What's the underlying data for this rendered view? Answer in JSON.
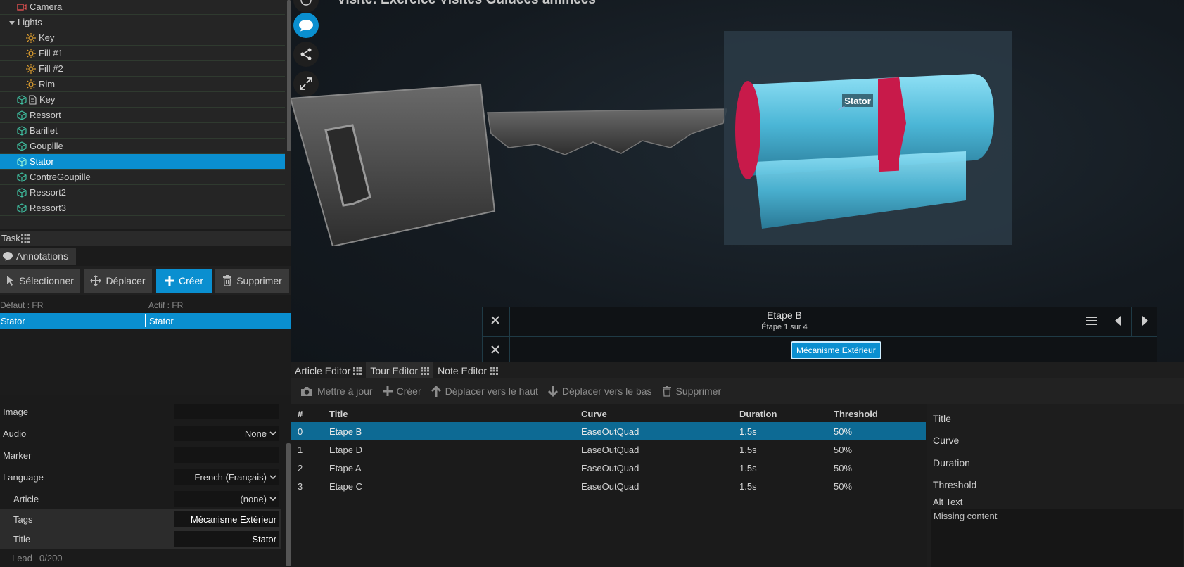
{
  "scene_tree": {
    "items": [
      {
        "label": "Camera",
        "icon": "camera-icon",
        "indent": 1
      },
      {
        "label": "Lights",
        "icon": "caret-down-icon",
        "indent": 0
      },
      {
        "label": "Key",
        "icon": "light-icon",
        "indent": 2
      },
      {
        "label": "Fill #1",
        "icon": "light-icon",
        "indent": 2
      },
      {
        "label": "Fill #2",
        "icon": "light-icon",
        "indent": 2
      },
      {
        "label": "Rim",
        "icon": "light-icon",
        "indent": 2
      },
      {
        "label": "Key",
        "icon": "cube-icon",
        "indent": 1
      },
      {
        "label": "Ressort",
        "icon": "cube-icon",
        "indent": 1
      },
      {
        "label": "Barillet",
        "icon": "cube-icon",
        "indent": 1
      },
      {
        "label": "Goupille",
        "icon": "cube-icon",
        "indent": 1
      },
      {
        "label": "Stator",
        "icon": "cube-icon",
        "indent": 1
      },
      {
        "label": "ContreGoupille",
        "icon": "cube-icon",
        "indent": 1
      },
      {
        "label": "Ressort2",
        "icon": "cube-icon",
        "indent": 1
      },
      {
        "label": "Ressort3",
        "icon": "cube-icon",
        "indent": 1
      }
    ],
    "selected_label": "Stator"
  },
  "task": {
    "tab_label": "Task"
  },
  "annotations": {
    "tab_label": "Annotations",
    "toolbar": {
      "select_label": "Sélectionner",
      "move_label": "Déplacer",
      "create_label": "Créer",
      "delete_label": "Supprimer"
    },
    "lang_default": "Défaut : FR",
    "lang_active": "Actif : FR",
    "row_default": "Stator",
    "row_active": "Stator"
  },
  "properties": {
    "image_label": "Image",
    "image_value": "",
    "audio_label": "Audio",
    "audio_value": "None",
    "marker_label": "Marker",
    "marker_value": "",
    "language_label": "Language",
    "language_value": "French (Français)",
    "article_label": "Article",
    "article_value": "(none)",
    "tags_label": "Tags",
    "tags_value": "Mécanisme Extérieur",
    "title_label": "Title",
    "title_value": "Stator",
    "lead_label": "Lead",
    "lead_count": "0/200"
  },
  "viewport": {
    "header_title": "Visite: Exercice Visites Guidées animées",
    "annotation_label": "Stator",
    "step_title": "Etape B",
    "step_counter": "Étape 1 sur 4",
    "tag_label": "Mécanisme Extérieur",
    "colors": {
      "accent": "#0a8fd0",
      "cylinder": "#5fc0dd",
      "cam": "#c81a4a"
    }
  },
  "editor_tabs": {
    "article": "Article Editor",
    "tour": "Tour Editor",
    "note": "Note Editor"
  },
  "tour_toolbar": {
    "update": "Mettre à jour",
    "create": "Créer",
    "move_up": "Déplacer vers le haut",
    "move_down": "Déplacer vers le bas",
    "delete": "Supprimer"
  },
  "tour_table": {
    "headers": {
      "num": "#",
      "title": "Title",
      "curve": "Curve",
      "duration": "Duration",
      "threshold": "Threshold"
    },
    "rows": [
      {
        "num": "0",
        "title": "Etape B",
        "curve": "EaseOutQuad",
        "duration": "1.5s",
        "threshold": "50%"
      },
      {
        "num": "1",
        "title": "Etape D",
        "curve": "EaseOutQuad",
        "duration": "1.5s",
        "threshold": "50%"
      },
      {
        "num": "2",
        "title": "Etape A",
        "curve": "EaseOutQuad",
        "duration": "1.5s",
        "threshold": "50%"
      },
      {
        "num": "3",
        "title": "Etape C",
        "curve": "EaseOutQuad",
        "duration": "1.5s",
        "threshold": "50%"
      }
    ]
  },
  "tour_detail": {
    "title_label": "Title",
    "curve_label": "Curve",
    "duration_label": "Duration",
    "threshold_label": "Threshold",
    "alt_text_label": "Alt Text",
    "alt_text_value": "Missing content"
  }
}
